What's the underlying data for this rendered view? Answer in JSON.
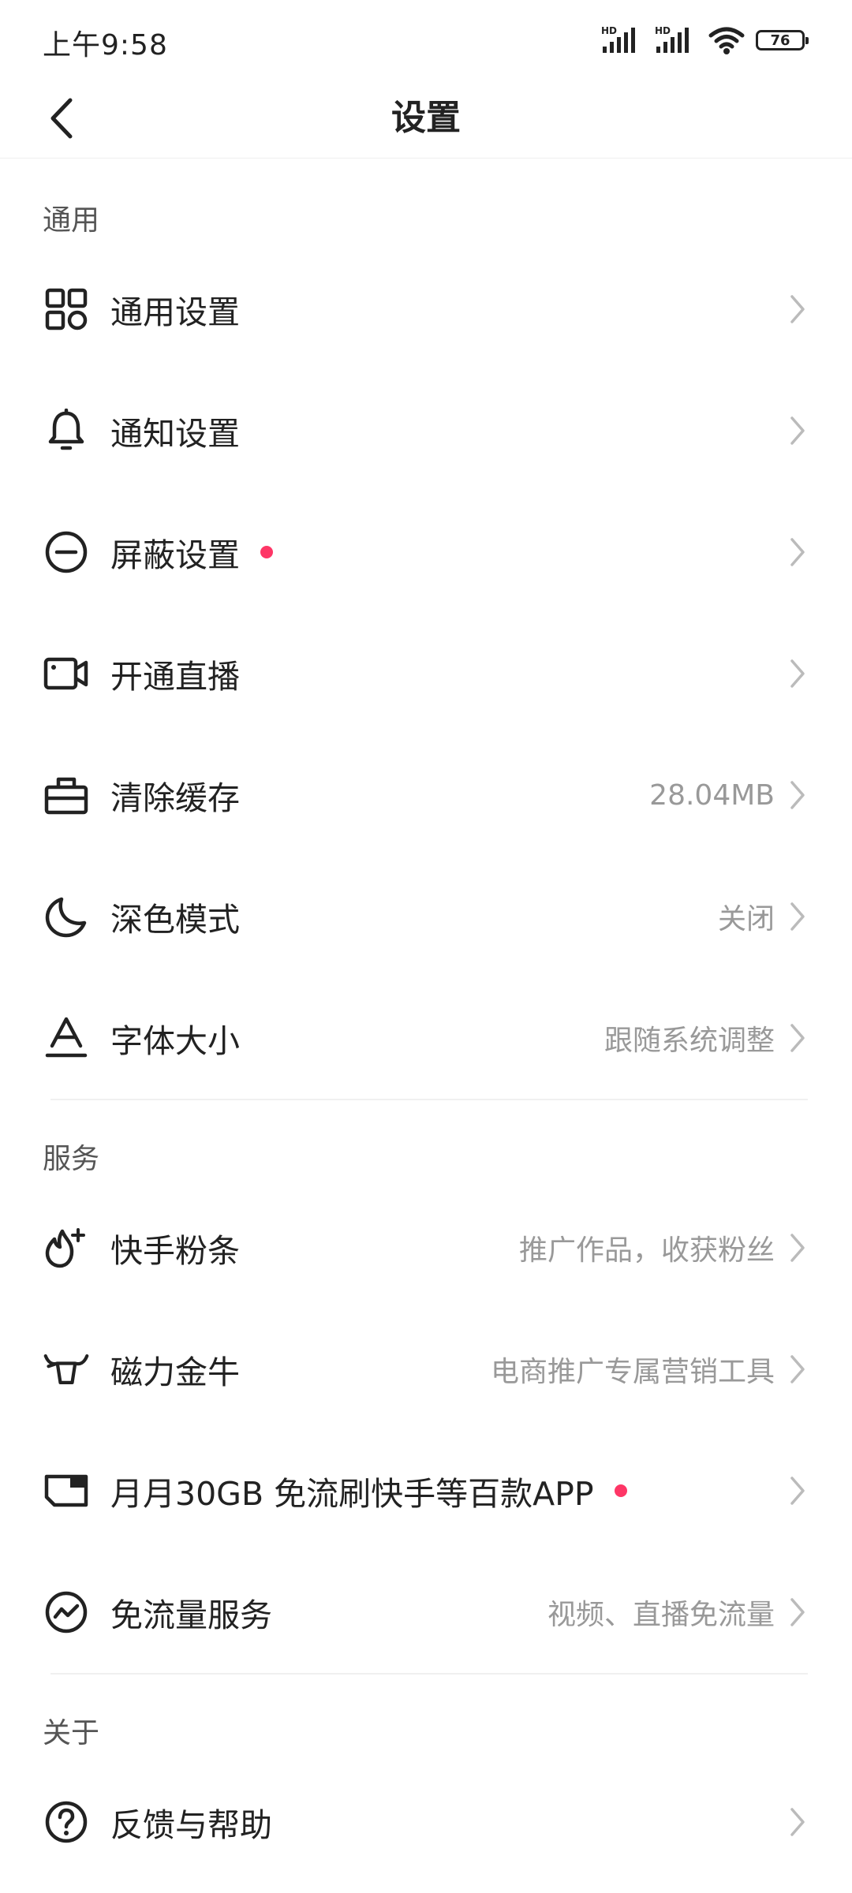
{
  "status_bar": {
    "time": "上午9:58",
    "signal1_label": "HD",
    "signal2_label": "HD",
    "battery": "76",
    "wifi_icon": "wifi-icon"
  },
  "nav": {
    "title": "设置",
    "back_icon": "chevron-left-icon"
  },
  "colors": {
    "dot": "#fe3666",
    "text_primary": "#222222",
    "text_secondary": "#999999",
    "section_header": "#555555"
  },
  "sections": {
    "general": {
      "header": "通用",
      "items": [
        {
          "icon": "grid-icon",
          "label": "通用设置",
          "value": ""
        },
        {
          "icon": "bell-icon",
          "label": "通知设置",
          "value": ""
        },
        {
          "icon": "block-icon",
          "label": "屏蔽设置",
          "value": "",
          "dot": true
        },
        {
          "icon": "video-camera-icon",
          "label": "开通直播",
          "value": ""
        },
        {
          "icon": "toolbox-icon",
          "label": "清除缓存",
          "value": "28.04MB"
        },
        {
          "icon": "moon-icon",
          "label": "深色模式",
          "value": "关闭"
        },
        {
          "icon": "font-size-icon",
          "label": "字体大小",
          "value": "跟随系统调整"
        }
      ]
    },
    "services": {
      "header": "服务",
      "items": [
        {
          "icon": "flame-plus-icon",
          "label": "快手粉条",
          "value": "推广作品，收获粉丝"
        },
        {
          "icon": "bull-icon",
          "label": "磁力金牛",
          "value": "电商推广专属营销工具"
        },
        {
          "icon": "sim-card-icon",
          "label": "月月30GB 免流刷快手等百款APP",
          "value": "",
          "dot": true
        },
        {
          "icon": "data-free-icon",
          "label": "免流量服务",
          "value": "视频、直播免流量"
        }
      ]
    },
    "about": {
      "header": "关于",
      "items": [
        {
          "icon": "help-icon",
          "label": "反馈与帮助",
          "value": ""
        }
      ]
    }
  }
}
